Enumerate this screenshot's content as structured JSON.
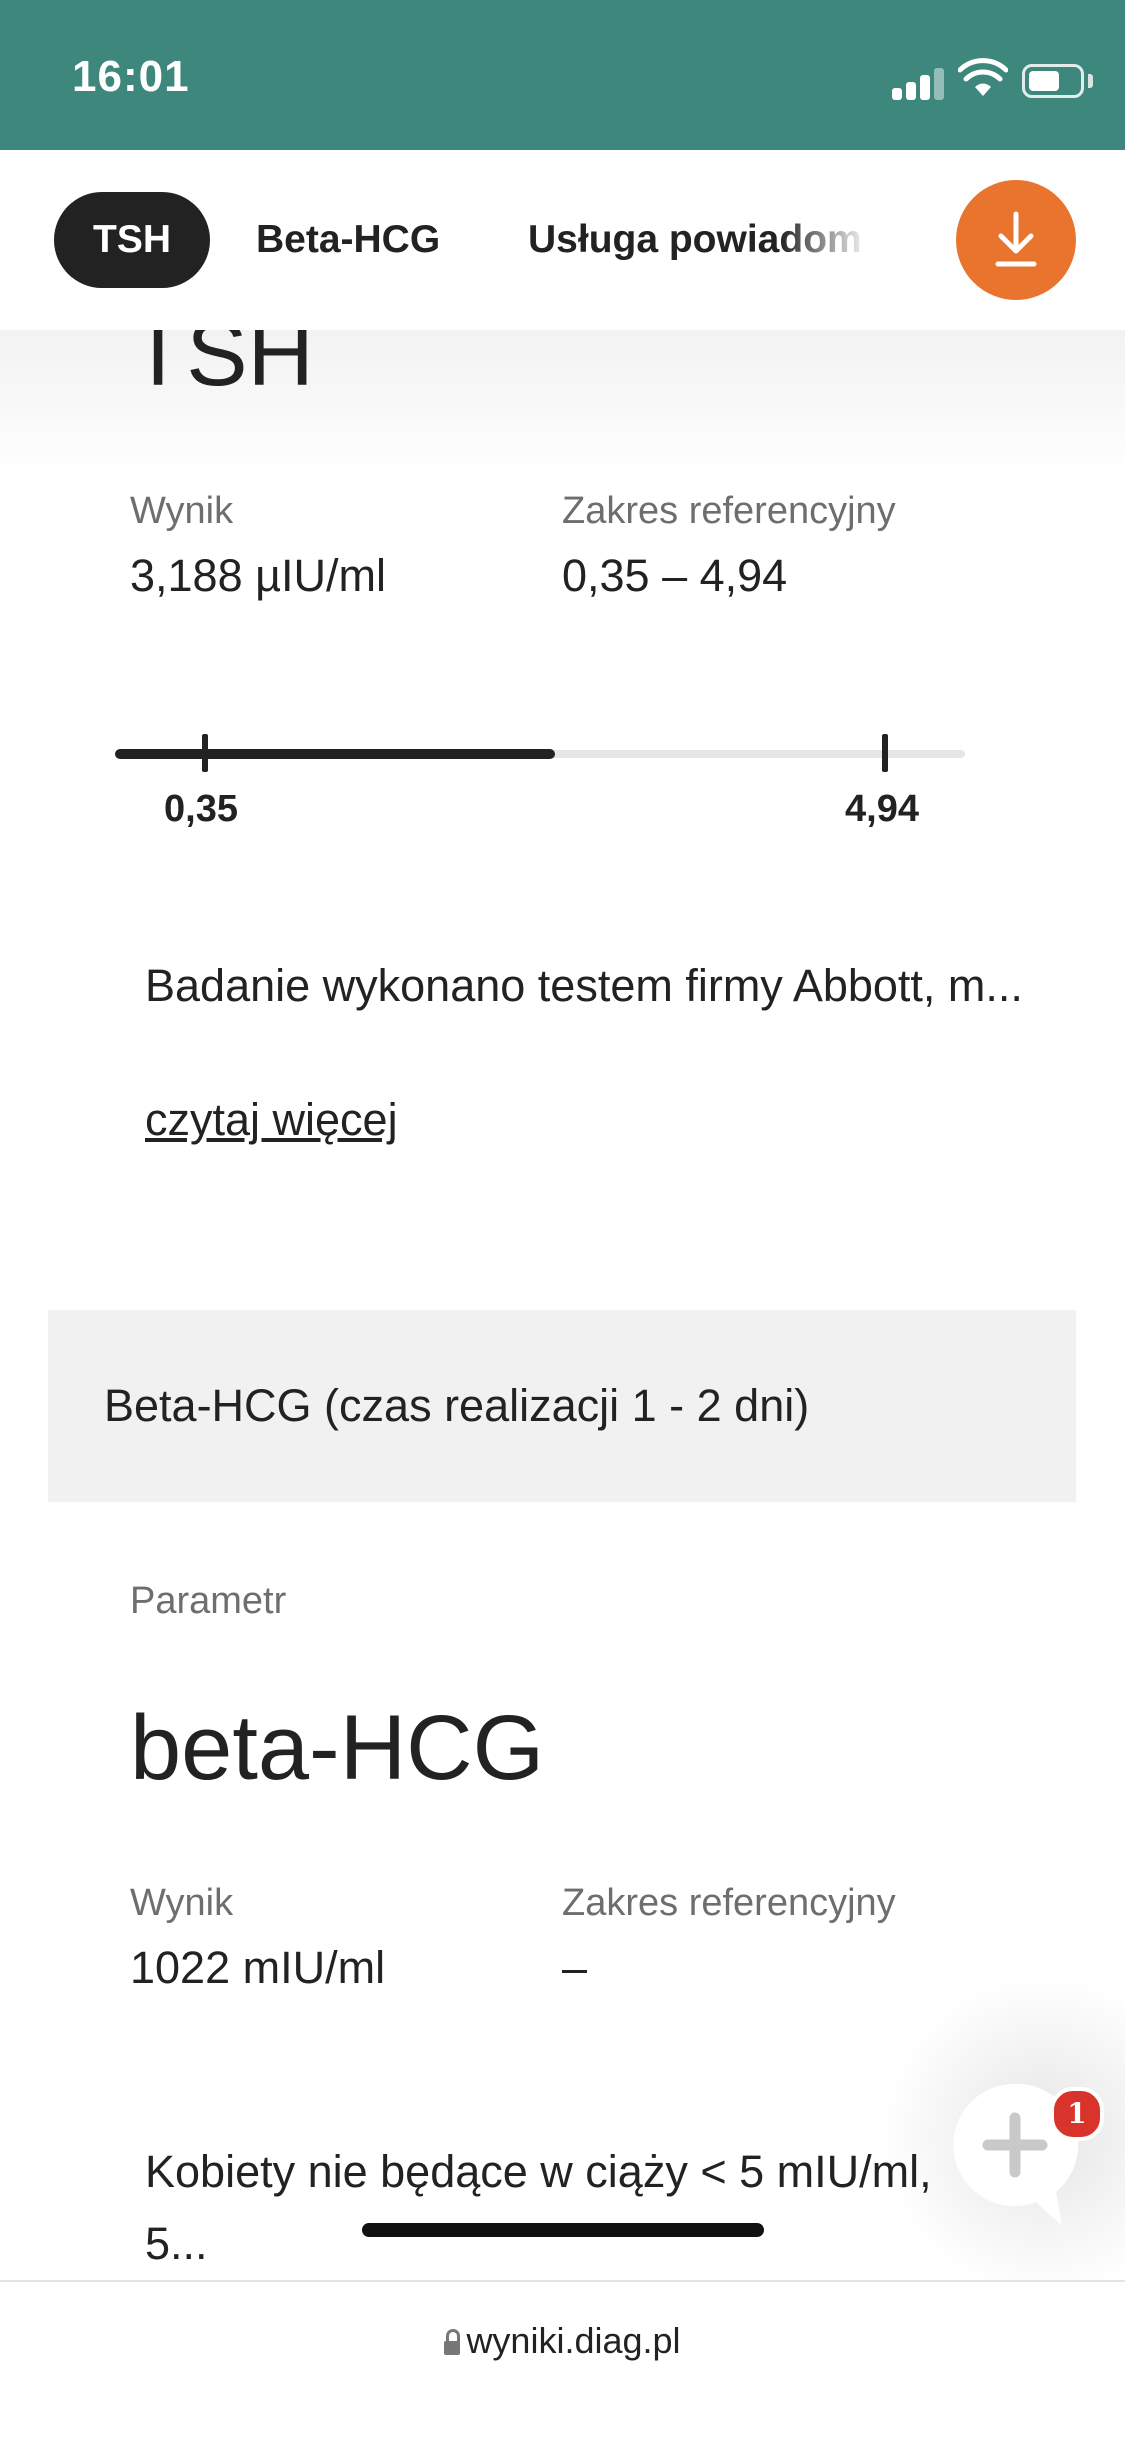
{
  "status_bar": {
    "time": "16:01"
  },
  "tabs": [
    {
      "label": "TSH",
      "active": true
    },
    {
      "label": "Beta-HCG",
      "active": false
    },
    {
      "label": "Usługa powiadom",
      "active": false
    }
  ],
  "tsh": {
    "title": "TSH",
    "result_label": "Wynik",
    "result_value": "3,188 µIU/ml",
    "reference_label": "Zakres referencyjny",
    "reference_value": "0,35 – 4,94",
    "range_min_label": "0,35",
    "range_max_label": "4,94",
    "description": "Badanie wykonano testem firmy Abbott, m...",
    "read_more": "czytaj więcej"
  },
  "beta_section": {
    "section_title": "Beta-HCG (czas realizacji 1 - 2 dni)",
    "param_label": "Parametr",
    "param_title": "beta-HCG",
    "result_label": "Wynik",
    "result_value": "1022 mIU/ml",
    "reference_label": "Zakres referencyjny",
    "reference_value": "–",
    "description_line1": "Kobiety nie będące w ciąży < 5 mIU/ml,",
    "description_line2": "5..."
  },
  "chat": {
    "badge_count": "1"
  },
  "url_bar": {
    "url": "wyniki.diag.pl"
  },
  "colors": {
    "status_bar": "#3d877c",
    "download_button": "#e8742e",
    "badge": "#d9342b"
  }
}
